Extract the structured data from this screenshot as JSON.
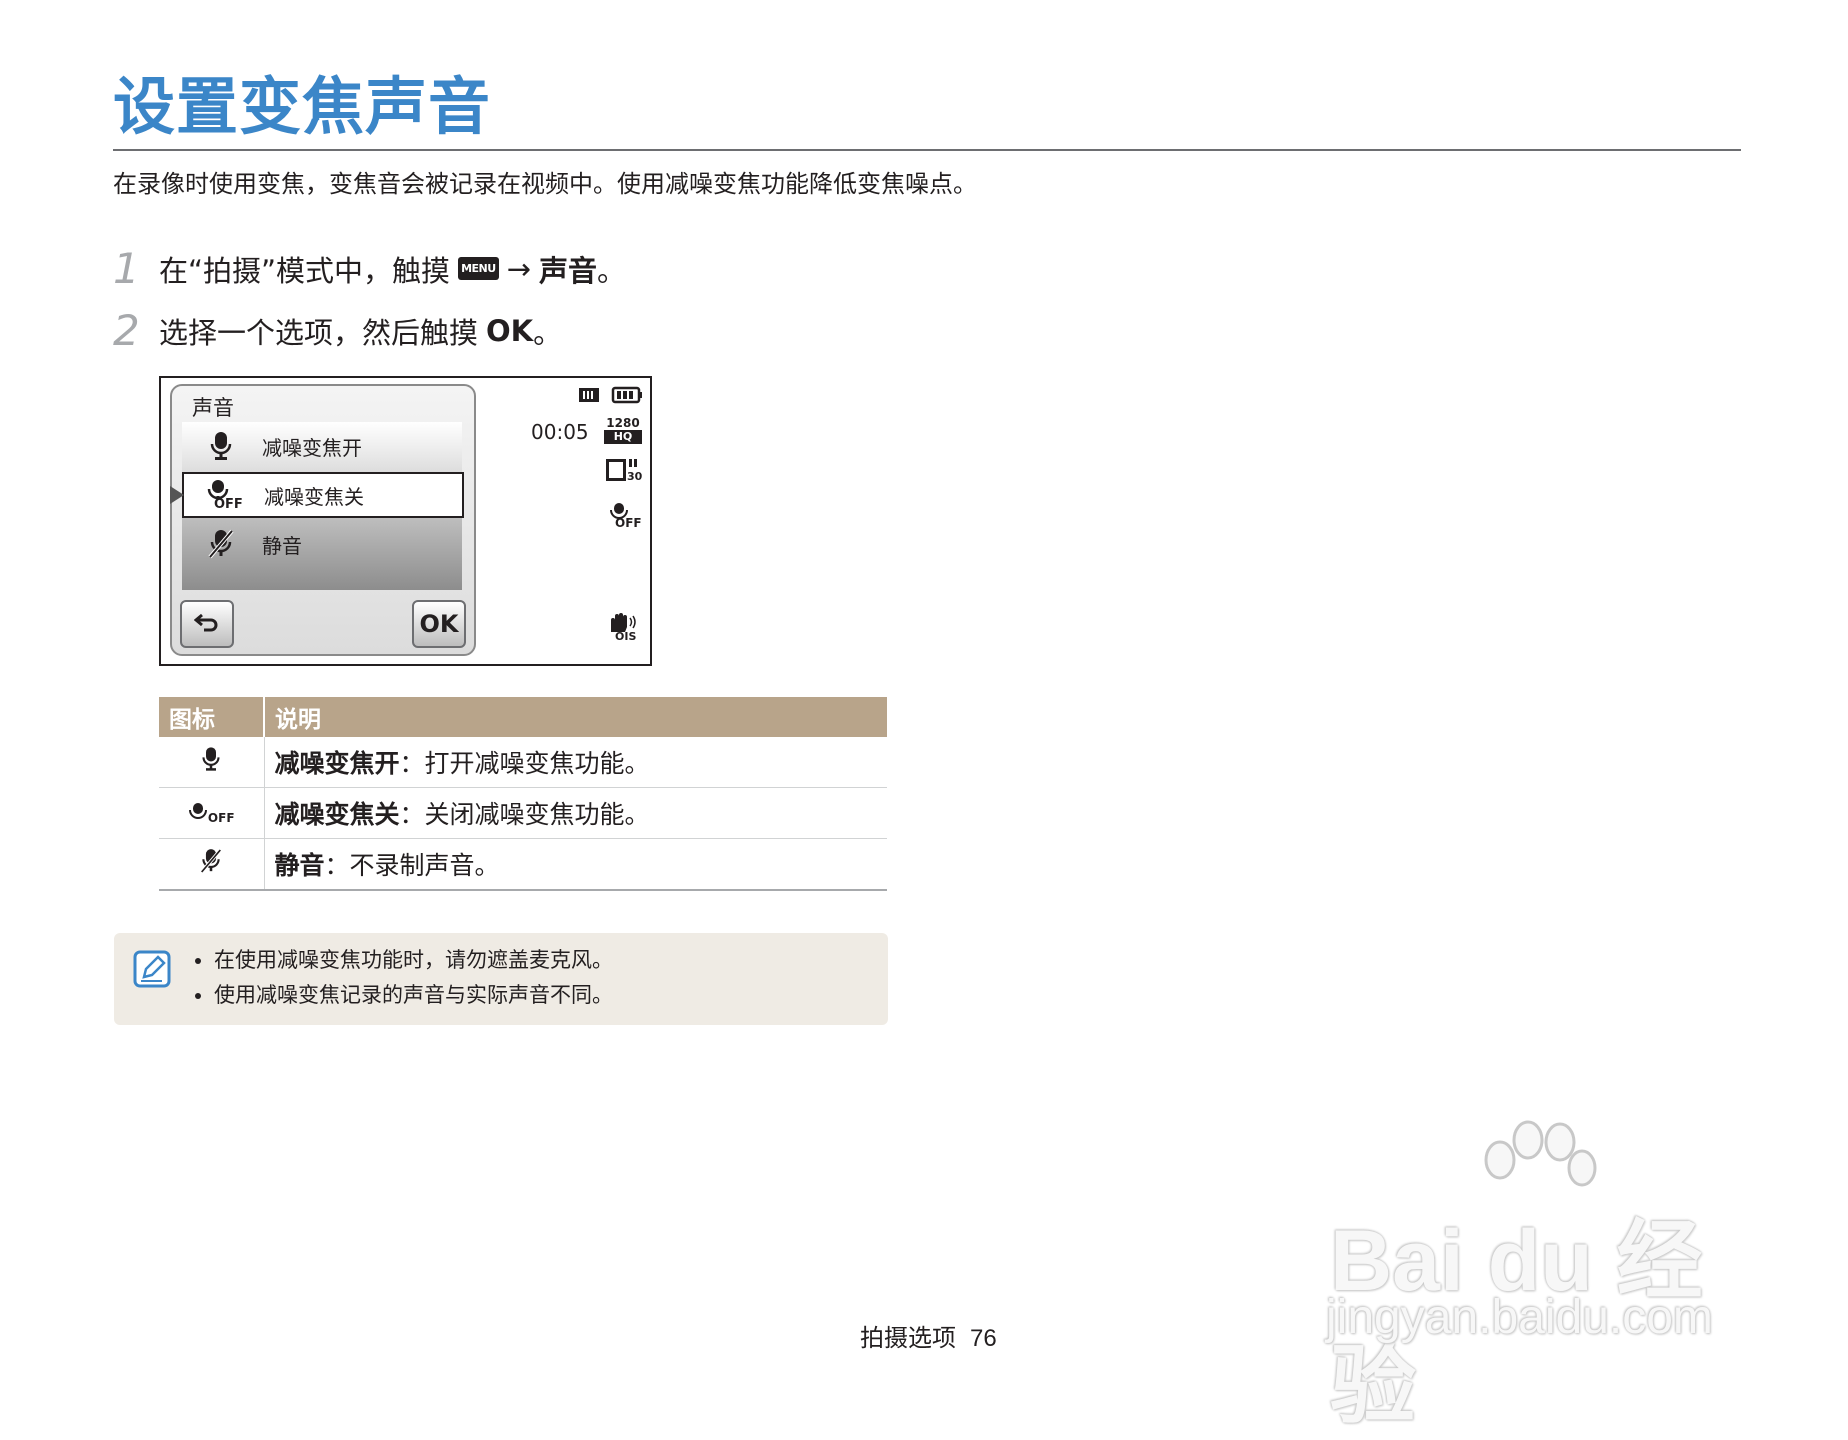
{
  "page": {
    "title": "设置变焦声音",
    "intro": "在录像时使用变焦，变焦音会被记录在视频中。使用减噪变焦功能降低变焦噪点。"
  },
  "steps": [
    {
      "num": "1",
      "text_pre": "在“拍摄”模式中，触摸",
      "menu_icon": "MENU",
      "arrow": "→",
      "bold": "声音",
      "text_post": "。"
    },
    {
      "num": "2",
      "text_pre": "选择一个选项，然后触摸",
      "bold": "OK",
      "text_post": "。"
    }
  ],
  "screen": {
    "panel_title": "声音",
    "items": [
      {
        "label": "减噪变焦开",
        "icon": "mic-icon",
        "selected": false
      },
      {
        "label": "减噪变焦关",
        "icon": "mic-off-icon",
        "selected": true
      },
      {
        "label": "静音",
        "icon": "mute-icon",
        "selected": false
      }
    ],
    "back_icon": "back-arrow-icon",
    "ok_label": "OK",
    "time": "00:05",
    "resolution": "1280",
    "quality": "HQ",
    "fps": "30",
    "off_label": "OFF",
    "ois_label": "OIS"
  },
  "table": {
    "headers": [
      "图标",
      "说明"
    ],
    "rows": [
      {
        "icon": "mic-icon",
        "name": "减噪变焦开",
        "desc": "：打开减噪变焦功能。"
      },
      {
        "icon": "mic-off-icon",
        "name": "减噪变焦关",
        "desc": "：关闭减噪变焦功能。"
      },
      {
        "icon": "mute-icon",
        "name": "静音",
        "desc": "：不录制声音。"
      }
    ]
  },
  "note": {
    "icon": "note-pencil-icon",
    "items": [
      "在使用减噪变焦功能时，请勿遮盖麦克风。",
      "使用减噪变焦记录的声音与实际声音不同。"
    ]
  },
  "watermark": {
    "main": "Bai du 经验",
    "sub": "jingyan.baidu.com"
  },
  "footer": {
    "section": "拍摄选项",
    "page_number": "76"
  },
  "colors": {
    "title": "#3b86c8",
    "table_header": "#b8a48a",
    "note_bg": "#efebe4"
  }
}
